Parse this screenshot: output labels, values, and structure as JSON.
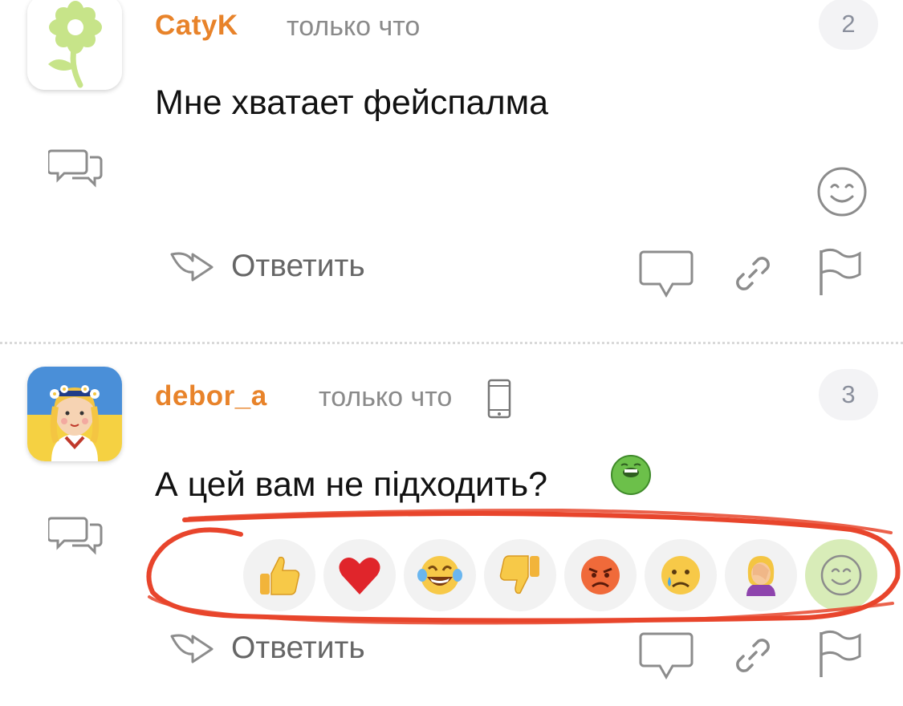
{
  "comments": [
    {
      "username": "CatyK",
      "time": "только что",
      "number": "2",
      "text": "Мне хватает фейспалма",
      "reply_label": "Ответить",
      "avatar": "daisy-flower-avatar"
    },
    {
      "username": "debor_a",
      "time": "только что",
      "number": "3",
      "text": "А цей вам не підходить?",
      "reply_label": "Ответить",
      "avatar": "ukrainian-girl-avatar",
      "inline_emoji": "nauseated-green-face",
      "reactions": [
        "thumbs-up",
        "heart",
        "laughing-tears",
        "thumbs-down",
        "angry-face",
        "crying-face",
        "facepalm-woman",
        "smiley-picker"
      ]
    }
  ],
  "colors": {
    "username": "#e8832a",
    "time": "#8a8a8a",
    "icon_gray": "#8c8c8c",
    "annotation_red": "#e8452c",
    "picker_bg": "#d8ecb8"
  }
}
